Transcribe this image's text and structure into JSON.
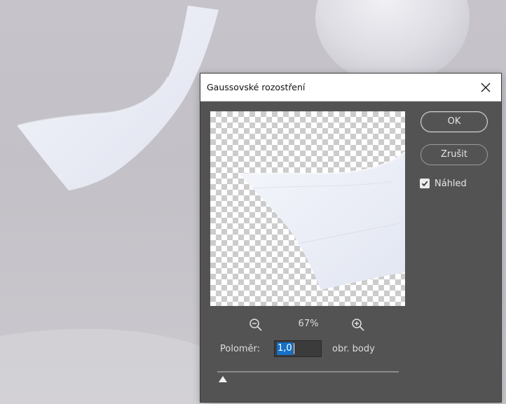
{
  "dialog": {
    "title": "Gaussovské rozostření",
    "ok_label": "OK",
    "cancel_label": "Zrušit",
    "preview_checkbox": {
      "label": "Náhled",
      "checked": true
    },
    "zoom": {
      "level": "67%"
    },
    "radius": {
      "label": "Poloměr:",
      "value": "1,0",
      "unit": "obr. body",
      "slider_fraction": 0.01
    }
  },
  "icons": {
    "close": "close-icon",
    "zoom_out": "zoom-out-icon",
    "zoom_in": "zoom-in-icon",
    "checkbox": "checkmark-icon",
    "slider_thumb": "slider-thumb-icon"
  },
  "colors": {
    "dialog_bg": "#535353",
    "titlebar_bg": "#ffffff",
    "selection": "#1470c8"
  }
}
